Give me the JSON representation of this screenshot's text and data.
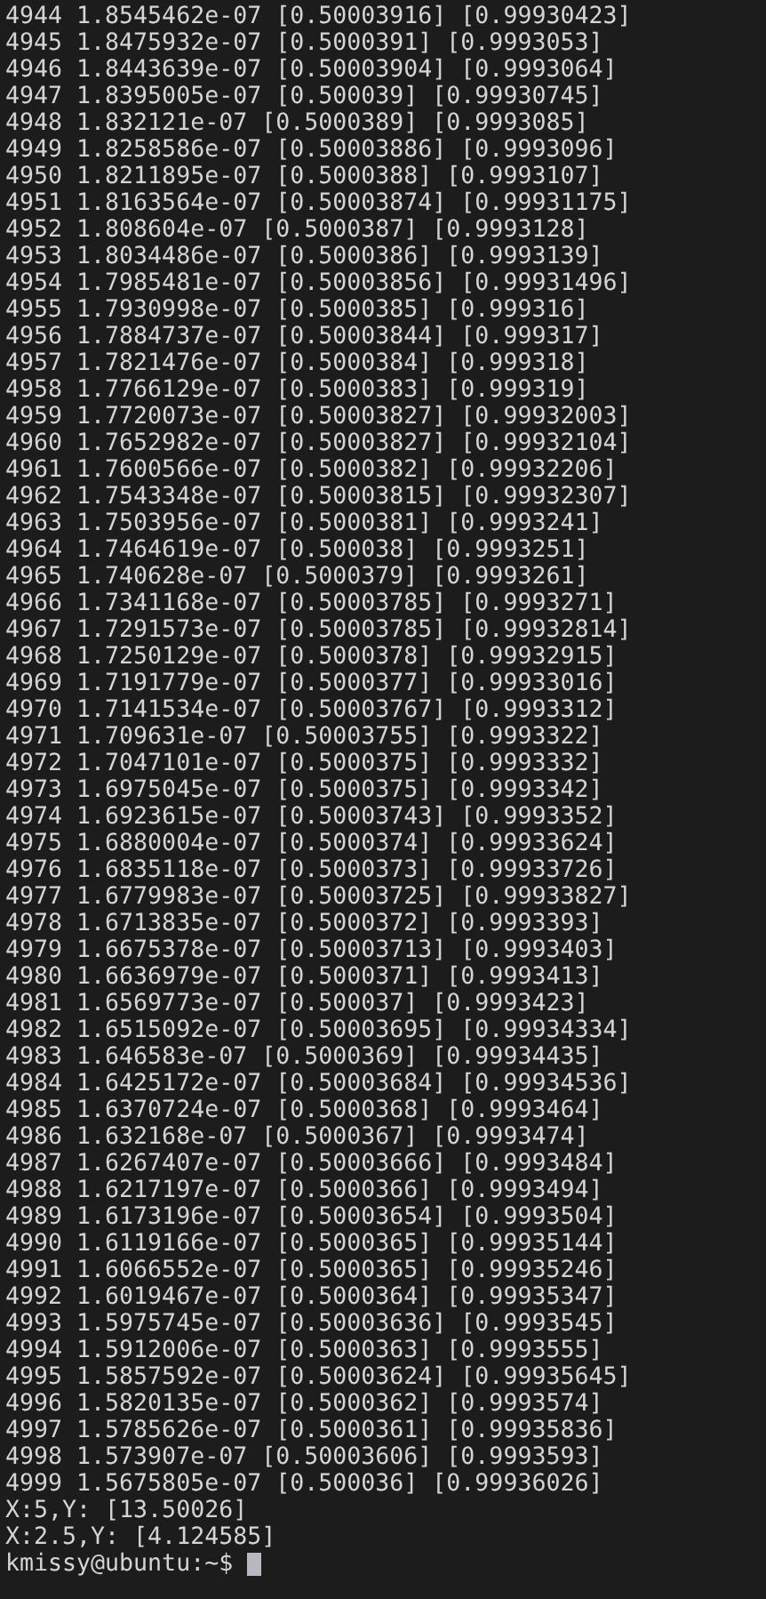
{
  "terminal": {
    "lines": [
      "4944 1.8545462e-07 [0.50003916] [0.99930423]",
      "4945 1.8475932e-07 [0.5000391] [0.9993053]",
      "4946 1.8443639e-07 [0.50003904] [0.9993064]",
      "4947 1.8395005e-07 [0.500039] [0.99930745]",
      "4948 1.832121e-07 [0.5000389] [0.9993085]",
      "4949 1.8258586e-07 [0.50003886] [0.9993096]",
      "4950 1.8211895e-07 [0.5000388] [0.9993107]",
      "4951 1.8163564e-07 [0.50003874] [0.99931175]",
      "4952 1.808604e-07 [0.5000387] [0.9993128]",
      "4953 1.8034486e-07 [0.5000386] [0.9993139]",
      "4954 1.7985481e-07 [0.50003856] [0.99931496]",
      "4955 1.7930998e-07 [0.5000385] [0.999316]",
      "4956 1.7884737e-07 [0.50003844] [0.999317]",
      "4957 1.7821476e-07 [0.5000384] [0.999318]",
      "4958 1.7766129e-07 [0.5000383] [0.999319]",
      "4959 1.7720073e-07 [0.50003827] [0.99932003]",
      "4960 1.7652982e-07 [0.50003827] [0.99932104]",
      "4961 1.7600566e-07 [0.5000382] [0.99932206]",
      "4962 1.7543348e-07 [0.50003815] [0.99932307]",
      "4963 1.7503956e-07 [0.5000381] [0.9993241]",
      "4964 1.7464619e-07 [0.500038] [0.9993251]",
      "4965 1.740628e-07 [0.5000379] [0.9993261]",
      "4966 1.7341168e-07 [0.50003785] [0.9993271]",
      "4967 1.7291573e-07 [0.50003785] [0.99932814]",
      "4968 1.7250129e-07 [0.5000378] [0.99932915]",
      "4969 1.7191779e-07 [0.5000377] [0.99933016]",
      "4970 1.7141534e-07 [0.50003767] [0.9993312]",
      "4971 1.709631e-07 [0.50003755] [0.9993322]",
      "4972 1.7047101e-07 [0.5000375] [0.9993332]",
      "4973 1.6975045e-07 [0.5000375] [0.9993342]",
      "4974 1.6923615e-07 [0.50003743] [0.9993352]",
      "4975 1.6880004e-07 [0.5000374] [0.99933624]",
      "4976 1.6835118e-07 [0.5000373] [0.99933726]",
      "4977 1.6779983e-07 [0.50003725] [0.99933827]",
      "4978 1.6713835e-07 [0.5000372] [0.9993393]",
      "4979 1.6675378e-07 [0.50003713] [0.9993403]",
      "4980 1.6636979e-07 [0.5000371] [0.9993413]",
      "4981 1.6569773e-07 [0.500037] [0.9993423]",
      "4982 1.6515092e-07 [0.50003695] [0.99934334]",
      "4983 1.646583e-07 [0.5000369] [0.99934435]",
      "4984 1.6425172e-07 [0.50003684] [0.99934536]",
      "4985 1.6370724e-07 [0.5000368] [0.9993464]",
      "4986 1.632168e-07 [0.5000367] [0.9993474]",
      "4987 1.6267407e-07 [0.50003666] [0.9993484]",
      "4988 1.6217197e-07 [0.5000366] [0.9993494]",
      "4989 1.6173196e-07 [0.50003654] [0.9993504]",
      "4990 1.6119166e-07 [0.5000365] [0.99935144]",
      "4991 1.6066552e-07 [0.5000365] [0.99935246]",
      "4992 1.6019467e-07 [0.5000364] [0.99935347]",
      "4993 1.5975745e-07 [0.50003636] [0.9993545]",
      "4994 1.5912006e-07 [0.5000363] [0.9993555]",
      "4995 1.5857592e-07 [0.50003624] [0.99935645]",
      "4996 1.5820135e-07 [0.5000362] [0.9993574]",
      "4997 1.5785626e-07 [0.5000361] [0.99935836]",
      "4998 1.573907e-07 [0.50003606] [0.9993593]",
      "4999 1.5675805e-07 [0.500036] [0.99936026]",
      "X:5,Y: [13.50026]",
      "X:2.5,Y: [4.124585]"
    ],
    "prompt": "kmissy@ubuntu:~$"
  }
}
